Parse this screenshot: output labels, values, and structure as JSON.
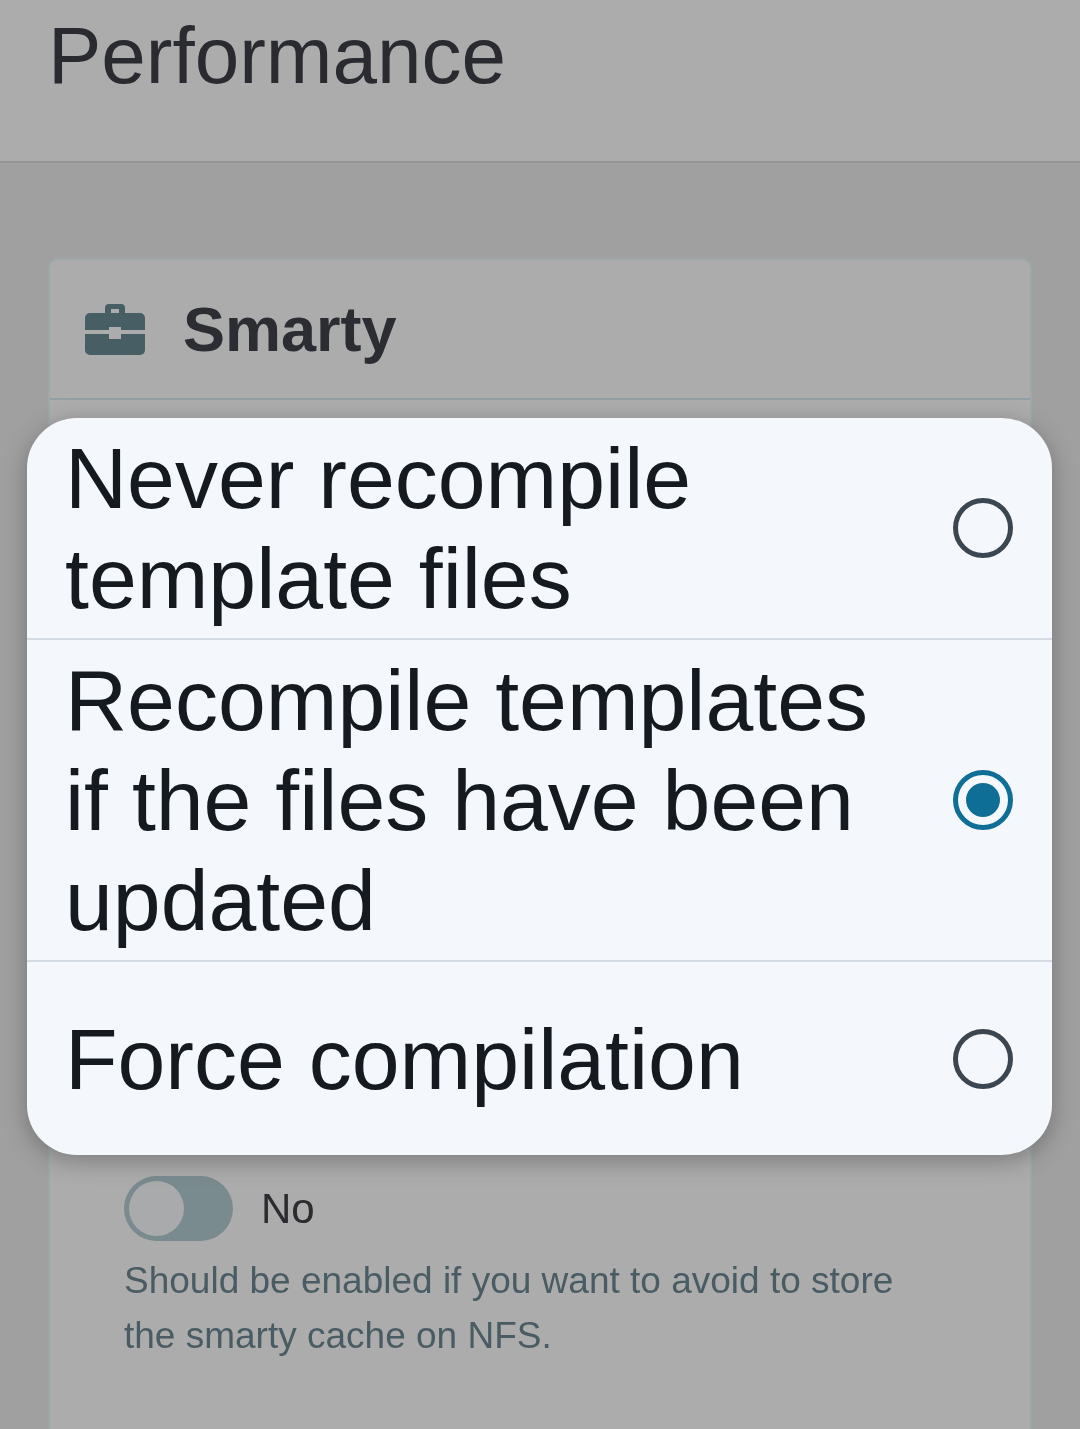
{
  "header": {
    "title": "Performance"
  },
  "card": {
    "title": "Smarty",
    "setting": {
      "on": false,
      "state_label": "No",
      "help": "Should be enabled if you want to avoid to store the smarty cache on NFS."
    }
  },
  "dialog": {
    "options": [
      {
        "label": "Never recompile template files",
        "selected": false
      },
      {
        "label": "Recompile templates if the files have been updated",
        "selected": true
      },
      {
        "label": "Force compilation",
        "selected": false
      }
    ]
  }
}
